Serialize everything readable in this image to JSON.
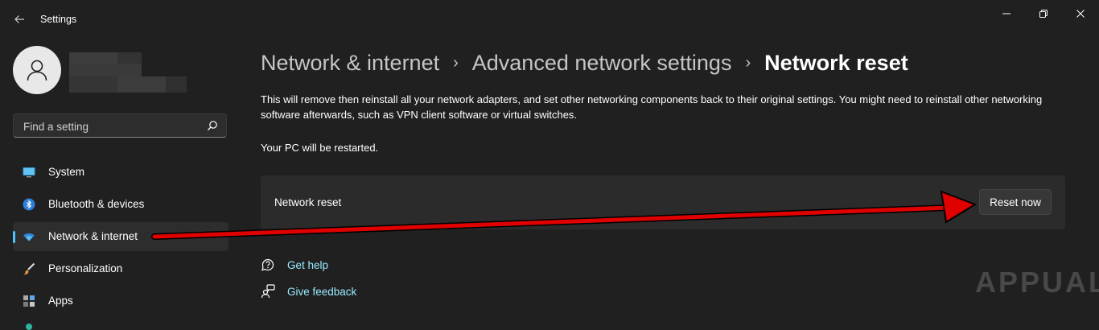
{
  "window": {
    "title": "Settings"
  },
  "sidebar": {
    "search": {
      "placeholder": "Find a setting"
    },
    "items": [
      {
        "label": "System",
        "icon": "system-icon"
      },
      {
        "label": "Bluetooth & devices",
        "icon": "bluetooth-icon"
      },
      {
        "label": "Network & internet",
        "icon": "wifi-icon",
        "active": true
      },
      {
        "label": "Personalization",
        "icon": "brush-icon"
      },
      {
        "label": "Apps",
        "icon": "apps-icon"
      }
    ]
  },
  "breadcrumb": [
    "Network & internet",
    "Advanced network settings",
    "Network reset"
  ],
  "main": {
    "description": "This will remove then reinstall all your network adapters, and set other networking components back to their original settings. You might need to reinstall other networking software afterwards, such as VPN client software or virtual switches.",
    "restart_note": "Your PC will be restarted.",
    "card": {
      "label": "Network reset",
      "button": "Reset now"
    },
    "links": [
      {
        "label": "Get help",
        "icon": "help-chat-icon"
      },
      {
        "label": "Give feedback",
        "icon": "feedback-icon"
      }
    ]
  },
  "watermark": "APPUALS",
  "colors": {
    "background": "#202020",
    "accent": "#4cc2ff",
    "link": "#99ebff",
    "annotation_arrow": "#e00000"
  }
}
